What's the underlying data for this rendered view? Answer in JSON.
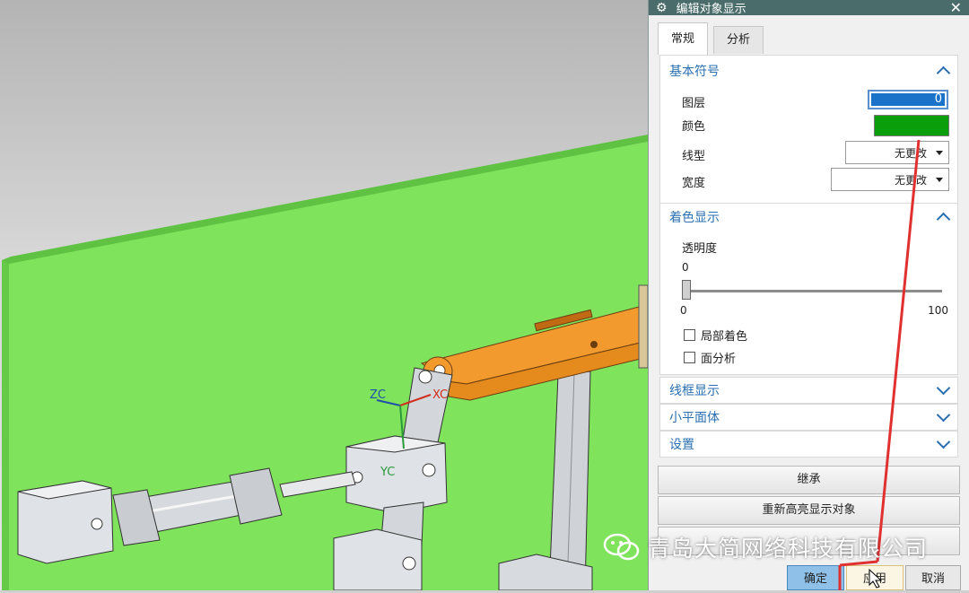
{
  "viewport": {
    "axis_labels": {
      "zc": "ZC",
      "xc": "XC",
      "yc": "YC"
    },
    "colors": {
      "plate": "#7fe35c",
      "arm": "#f29a2e",
      "axis_zc": "#1f4fa8",
      "axis_xc": "#d03020",
      "axis_yc": "#2a9a3a"
    }
  },
  "dialog": {
    "title": "编辑对象显示",
    "title_icon": "gear-icon",
    "close_icon": "close-icon",
    "tabs": [
      {
        "label": "常规",
        "active": true
      },
      {
        "label": "分析",
        "active": false
      }
    ],
    "basic_symbol": {
      "header": "基本符号",
      "layer_label": "图层",
      "layer_value": "0",
      "color_label": "颜色",
      "color_value": "#0a9e0a",
      "linetype_label": "线型",
      "linetype_value": "无更改",
      "width_label": "宽度",
      "width_value": "无更改"
    },
    "shading": {
      "header": "着色显示",
      "transparency_label": "透明度",
      "transparency_value": "0",
      "slider_min": "0",
      "slider_max": "100",
      "slider_level": 0,
      "partial_shading_label": "局部着色",
      "face_analysis_label": "面分析"
    },
    "collapsed_sections": [
      "线框显示",
      "小平面体",
      "设置"
    ],
    "buttons": {
      "inherit": "继承",
      "rehighlight": "重新高亮显示对象"
    },
    "footer": {
      "ok": "确定",
      "apply": "应用",
      "cancel": "取消"
    }
  },
  "watermark": {
    "text": "青岛大简网络科技有限公司",
    "icon": "wechat-icon"
  },
  "annotation_color": "#e03030"
}
